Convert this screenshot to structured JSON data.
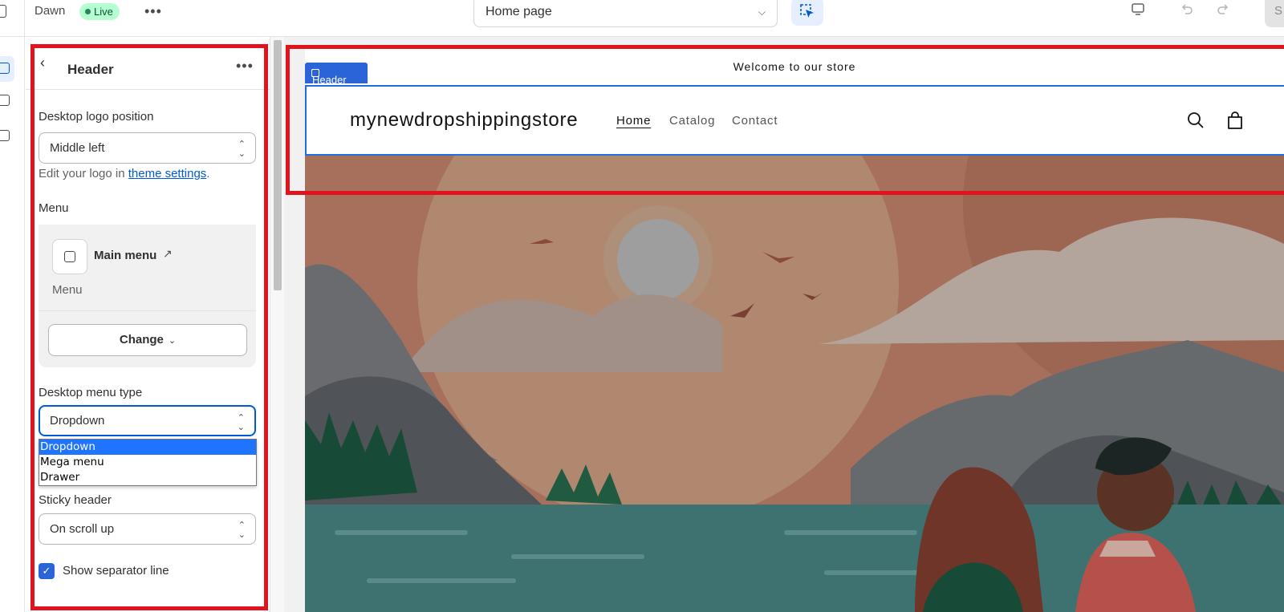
{
  "topbar": {
    "theme_name": "Dawn",
    "live_badge": "Live",
    "more_label": "•••",
    "page_selector": "Home page",
    "save_label": "S"
  },
  "panel": {
    "title": "Header",
    "more_label": "•••",
    "logo_position": {
      "label": "Desktop logo position",
      "value": "Middle left"
    },
    "help_prefix": "Edit your logo in ",
    "help_link": "theme settings",
    "help_suffix": ".",
    "menu": {
      "label": "Menu",
      "name": "Main menu",
      "subtitle": "Menu",
      "change_label": "Change"
    },
    "menu_type": {
      "label": "Desktop menu type",
      "value": "Dropdown",
      "options": [
        "Dropdown",
        "Mega menu",
        "Drawer"
      ]
    },
    "sticky": {
      "label": "Sticky header",
      "value": "On scroll up"
    },
    "separator_label": "Show separator line"
  },
  "preview": {
    "announcement": "Welcome to our store",
    "section_tag": "Header",
    "logo": "mynewdropshippingstore",
    "nav": [
      "Home",
      "Catalog",
      "Contact"
    ]
  },
  "colors": {
    "accent": "#005bd3",
    "annotation": "#e1141e",
    "selection_outline": "#1f6ee8"
  }
}
